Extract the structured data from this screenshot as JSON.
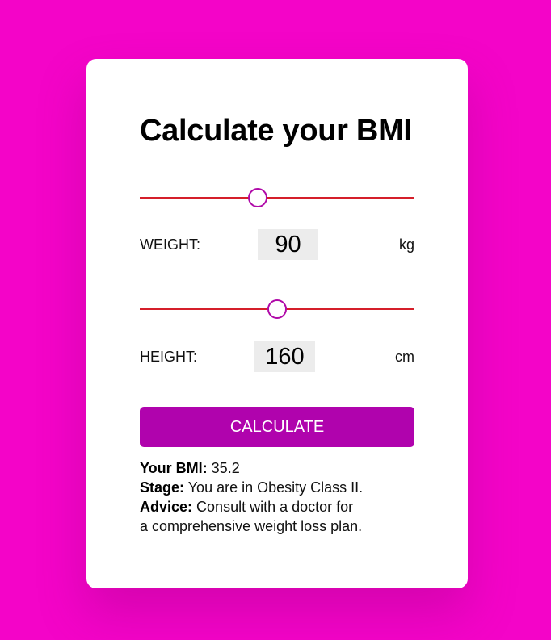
{
  "title": "Calculate your BMI",
  "colors": {
    "background": "#f404c8",
    "accent": "#b003ad",
    "track": "#d51f2a"
  },
  "weight": {
    "label": "WEIGHT:",
    "value": "90",
    "unit": "kg",
    "slider_fraction": 0.43
  },
  "height": {
    "label": "HEIGHT:",
    "value": "160",
    "unit": "cm",
    "slider_fraction": 0.5
  },
  "button": {
    "label": "CALCULATE"
  },
  "result": {
    "bmi_label": "Your BMI:",
    "bmi_value": "35.2",
    "stage_label": "Stage:",
    "stage_text": "You are in Obesity Class II.",
    "advice_label": "Advice:",
    "advice_line1": "Consult with a doctor for",
    "advice_line2": "a comprehensive weight loss plan."
  }
}
